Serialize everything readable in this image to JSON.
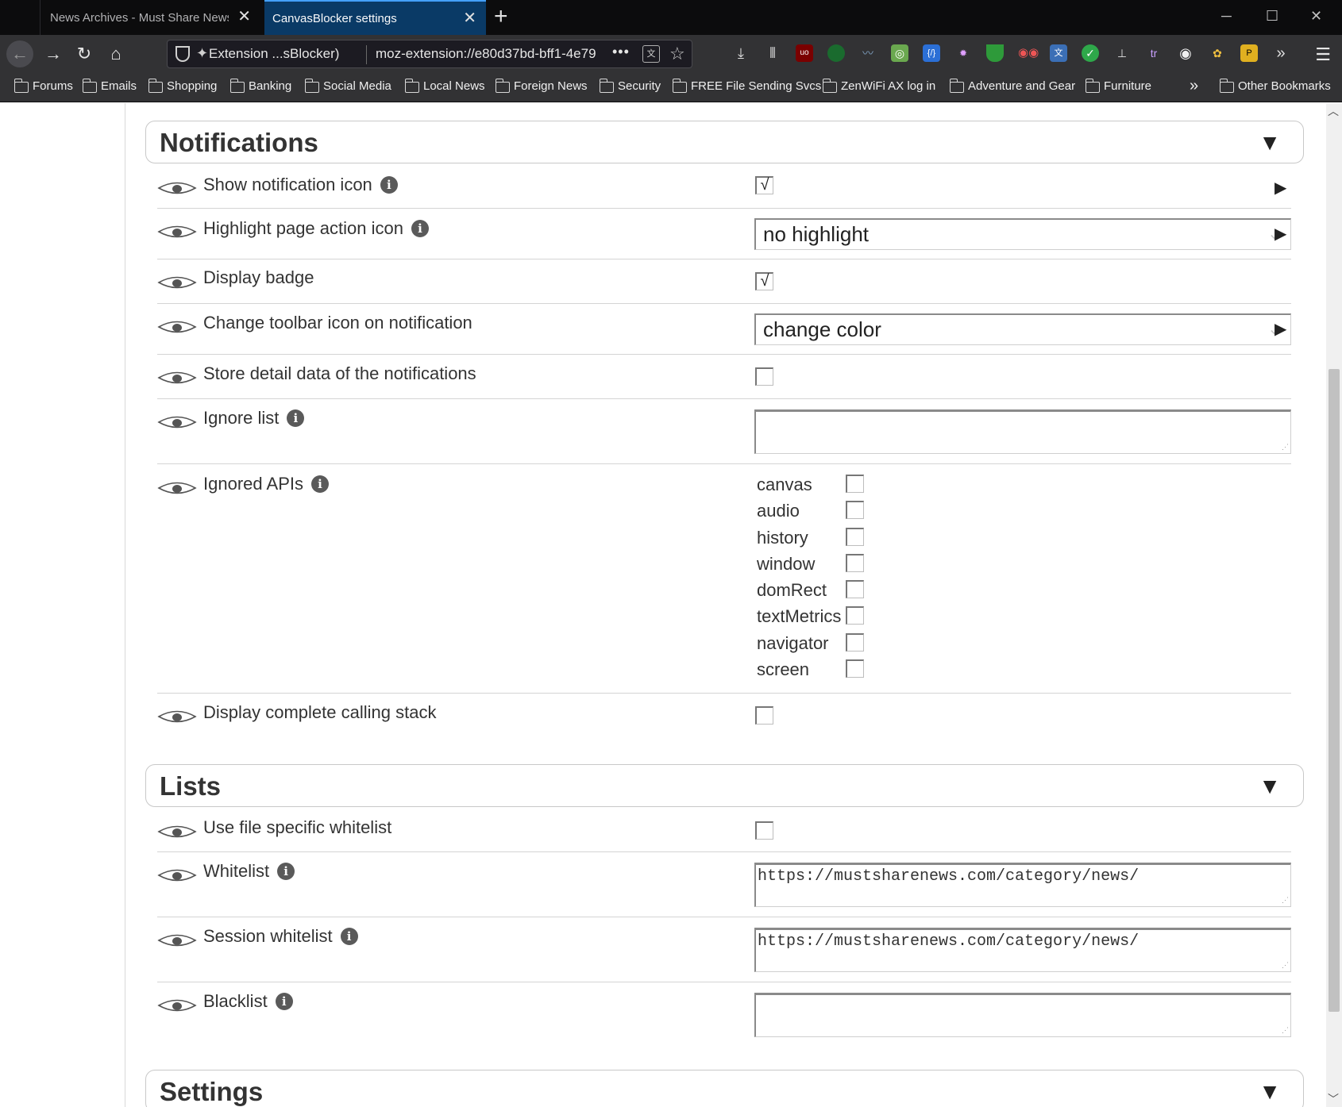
{
  "browser": {
    "tabs": [
      {
        "title": "News Archives - Must Share News -",
        "active": false
      },
      {
        "title": "CanvasBlocker settings",
        "active": true
      }
    ],
    "new_tab_label": "+",
    "url_identity": "Extension ...sBlocker)",
    "url": "moz-extension://e80d37bd-bff1-4e79",
    "url_more": "•••",
    "bookmarks": [
      "Forums",
      "Emails",
      "Shopping",
      "Banking",
      "Social Media",
      "Local News",
      "Foreign News",
      "Security",
      "FREE File Sending Svcs",
      "ZenWiFi AX log in",
      "Adventure and Gear",
      "Furniture"
    ],
    "other_bookmarks": "Other Bookmarks",
    "accent_color": "#45a1ff"
  },
  "notifications": {
    "title": "Notifications",
    "toggle": "▼",
    "rows": {
      "show_icon": {
        "label": "Show notification icon",
        "checked": true,
        "check_mark": "√"
      },
      "highlight": {
        "label": "Highlight page action icon",
        "value": "no highlight"
      },
      "badge": {
        "label": "Display badge",
        "checked": true,
        "check_mark": "√"
      },
      "toolbar": {
        "label": "Change toolbar icon on notification",
        "value": "change color"
      },
      "store": {
        "label": "Store detail data of the notifications",
        "checked": false
      },
      "ignore_list": {
        "label": "Ignore list",
        "value": ""
      },
      "ignored_apis": {
        "label": "Ignored APIs",
        "apis": [
          "canvas",
          "audio",
          "history",
          "window",
          "domRect",
          "textMetrics",
          "navigator",
          "screen"
        ]
      },
      "calling_stack": {
        "label": "Display complete calling stack",
        "checked": false
      }
    }
  },
  "lists": {
    "title": "Lists",
    "toggle": "▼",
    "rows": {
      "file_whitelist": {
        "label": "Use file specific whitelist",
        "checked": false
      },
      "whitelist": {
        "label": "Whitelist",
        "value": "https://mustsharenews.com/category/news/"
      },
      "session_whitelist": {
        "label": "Session whitelist",
        "value": "https://mustsharenews.com/category/news/"
      },
      "blacklist": {
        "label": "Blacklist",
        "value": ""
      }
    }
  },
  "settings": {
    "title": "Settings",
    "toggle": "▼"
  },
  "info_glyph": "i",
  "expand_glyph": "▶"
}
